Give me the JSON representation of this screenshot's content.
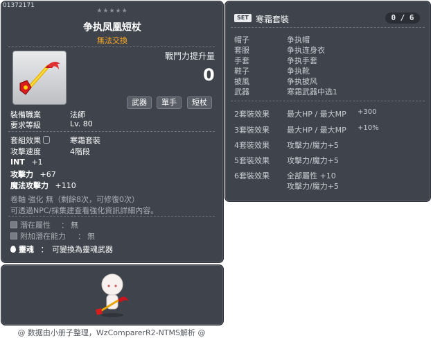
{
  "item": {
    "id": "01372171",
    "stars": "★★★★★",
    "name": "争执凤凰短杖",
    "trade": "無法交換",
    "boost_label": "戰鬥力提升量",
    "boost_value": "0",
    "tags": [
      "武器",
      "單手",
      "短杖"
    ],
    "job_label": "裝備職業",
    "job_value": "法師",
    "level_label": "要求等級",
    "level_value": "Lv. 80",
    "set_label": "套組效果",
    "set_value": "寒霜套裝",
    "speed_label": "攻擊速度",
    "speed_value": "4階段",
    "int_label": "INT",
    "int_value": "+1",
    "atk_label": "攻擊力",
    "atk_value": "+67",
    "matk_label": "魔法攻擊力",
    "matk_value": "+110",
    "scroll_text": "卷軸 強化 無（剩餘8次，可修復0次）",
    "npc_text": "可透過NPC/採集建查看強化資訊詳細內容。",
    "potential_label": "潛在屬性",
    "potential_value": "無",
    "add_potential_label": "附加潛在能力",
    "add_potential_value": "無",
    "soul_label": "靈魂",
    "soul_value": "可變換為靈魂武器",
    "colors": {
      "trade": "#ffaa22",
      "panel": "#3f444c"
    }
  },
  "set": {
    "badge": "SET",
    "title": "寒霜套裝",
    "count": "0 / 6",
    "parts": [
      {
        "slot": "帽子",
        "name": "争执帽"
      },
      {
        "slot": "套服",
        "name": "争执连身衣"
      },
      {
        "slot": "手套",
        "name": "争执手套"
      },
      {
        "slot": "鞋子",
        "name": "争执靴"
      },
      {
        "slot": "披風",
        "name": "争执披风"
      },
      {
        "slot": "武器",
        "name": "寒霜武器中选1"
      }
    ],
    "effects": [
      {
        "label": "2套裝效果",
        "lines": [
          [
            "最大HP / 最大MP",
            "+300"
          ]
        ]
      },
      {
        "label": "3套裝效果",
        "lines": [
          [
            "最大HP / 最大MP",
            "+10%"
          ]
        ]
      },
      {
        "label": "4套裝效果",
        "lines": [
          [
            "攻擊力/魔力+5",
            ""
          ]
        ]
      },
      {
        "label": "5套裝效果",
        "lines": [
          [
            "攻擊力/魔力+5",
            ""
          ]
        ]
      },
      {
        "label": "6套裝效果",
        "lines": [
          [
            "全部屬性  +10",
            ""
          ],
          [
            "攻擊力/魔力+5",
            ""
          ]
        ]
      }
    ]
  },
  "footer": "@ 数据由小册子整理，WzComparerR2-NTMS解析 @"
}
